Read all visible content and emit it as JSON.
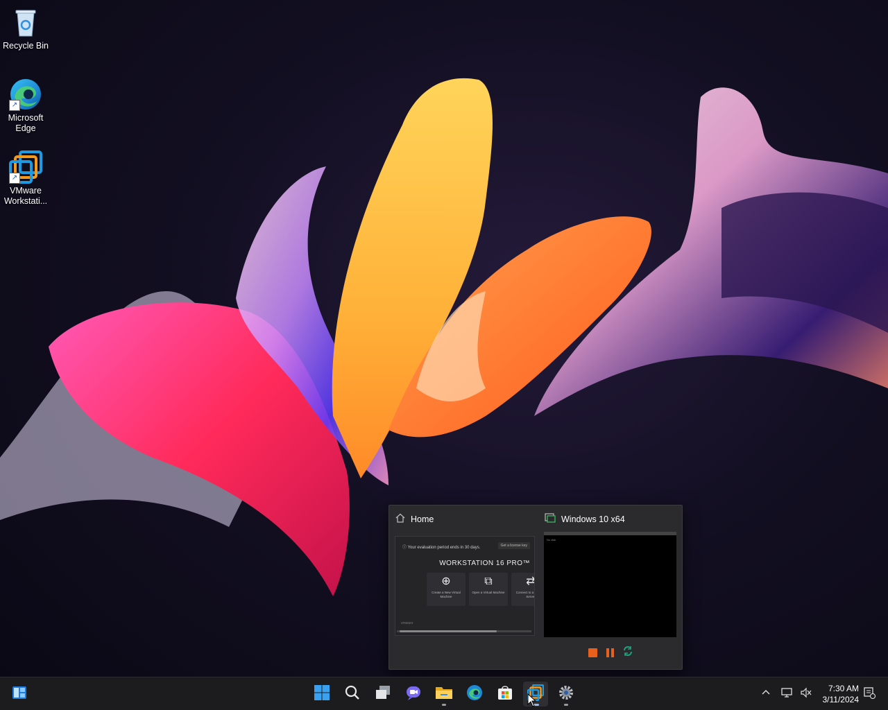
{
  "desktop": {
    "icons": [
      {
        "label": "Recycle Bin",
        "icon": "recycle-bin-icon"
      },
      {
        "label": "Microsoft Edge",
        "icon": "edge-icon"
      },
      {
        "label": "VMware Workstati...",
        "icon": "vmware-icon"
      }
    ]
  },
  "preview": {
    "home": {
      "title": "Home",
      "banner": "Your evaluation period ends in 30 days.",
      "license_button": "Get a license key",
      "product": "WORKSTATION 16 PRO™",
      "tiles": [
        {
          "label": "Create a New Virtual Machine"
        },
        {
          "label": "Open a Virtual Machine"
        },
        {
          "label": "Connect to a Remote Server"
        }
      ],
      "footer": "vmware"
    },
    "vm": {
      "title": "Windows 10 x64",
      "screen_status": "No disk"
    }
  },
  "taskbar": {
    "apps": [
      "start",
      "search",
      "task-view",
      "chat",
      "file-explorer",
      "edge",
      "store",
      "vmware",
      "settings"
    ]
  },
  "clock": {
    "time": "7:30 AM",
    "date": "3/11/2024"
  },
  "colors": {
    "taskbar_bg": "#1c1c1f",
    "preview_bg": "#2b2b2e",
    "vm_stop": "#e8601c",
    "vm_refresh": "#1fa37a"
  }
}
